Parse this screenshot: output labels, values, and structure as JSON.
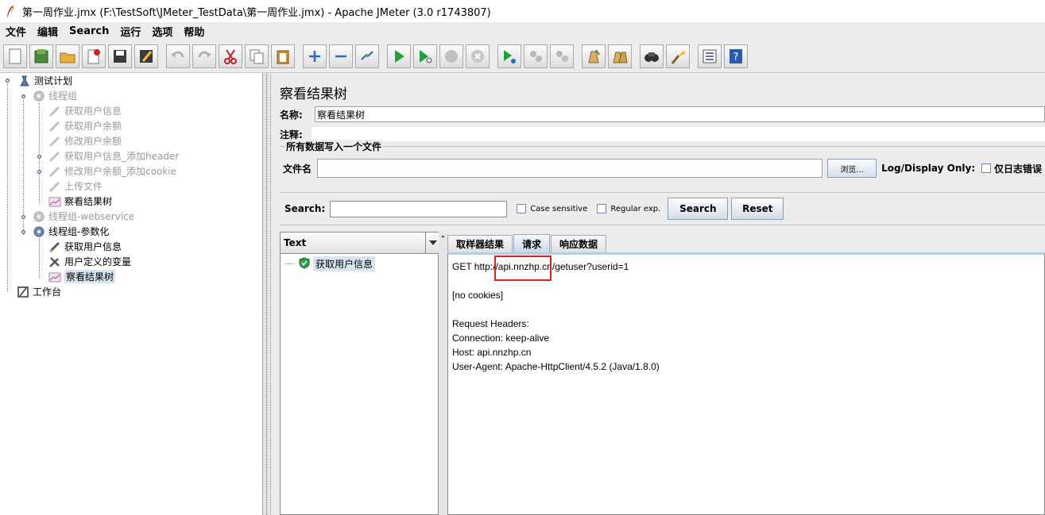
{
  "window": {
    "title": "第一周作业.jmx (F:\\TestSoft\\JMeter_TestData\\第一周作业.jmx) - Apache JMeter (3.0 r1743807)"
  },
  "menu": [
    "文件",
    "编辑",
    "Search",
    "运行",
    "选项",
    "帮助"
  ],
  "toolbar": {
    "icons": [
      "new-icon",
      "templates-icon",
      "open-icon",
      "close-icon",
      "save-icon",
      "save-as-icon",
      "undo-icon",
      "redo-icon",
      "cut-icon",
      "copy-icon",
      "paste-icon",
      "expand-icon",
      "collapse-icon",
      "toggle-icon",
      "start-icon",
      "start-no-pause-icon",
      "stop-icon",
      "shutdown-icon",
      "remote-start-icon",
      "remote-stop-icon",
      "remote-shutdown-icon",
      "clear-icon",
      "clear-all-icon",
      "search-icon",
      "reset-search-icon",
      "function-helper-icon",
      "help-icon"
    ]
  },
  "tree": {
    "items": [
      {
        "label": "测试计划",
        "icon": "test-plan-icon",
        "state": "normal"
      },
      {
        "label": "线程组",
        "icon": "gear-icon",
        "state": "disabled"
      },
      {
        "label": "获取用户信息",
        "icon": "pencil-icon",
        "state": "disabled"
      },
      {
        "label": "获取用户余额",
        "icon": "pencil-icon",
        "state": "disabled"
      },
      {
        "label": "修改用户余额",
        "icon": "pencil-icon",
        "state": "disabled"
      },
      {
        "label": "获取用户信息_添加header",
        "icon": "pencil-icon",
        "state": "disabled"
      },
      {
        "label": "修改用户余额_添加cookie",
        "icon": "pencil-icon",
        "state": "disabled"
      },
      {
        "label": "上传文件",
        "icon": "pencil-icon",
        "state": "disabled"
      },
      {
        "label": "察看结果树",
        "icon": "chart-icon",
        "state": "normal"
      },
      {
        "label": "线程组-webservice",
        "icon": "gear-icon",
        "state": "disabled"
      },
      {
        "label": "线程组-参数化",
        "icon": "gear-icon",
        "state": "normal"
      },
      {
        "label": "获取用户信息",
        "icon": "pencil-icon",
        "state": "normal"
      },
      {
        "label": "用户定义的变量",
        "icon": "wrench-icon",
        "state": "normal"
      },
      {
        "label": "察看结果树",
        "icon": "chart-icon",
        "state": "selected"
      },
      {
        "label": "工作台",
        "icon": "workbench-icon",
        "state": "normal"
      }
    ]
  },
  "panel": {
    "title": "察看结果树",
    "name_label": "名称:",
    "name_value": "察看结果树",
    "comment_label": "注释:",
    "file_group_label": "所有数据写入一个文件",
    "filename_label": "文件名",
    "browse_label": "浏览...",
    "log_display_label": "Log/Display Only:",
    "errors_only_label": "仅日志错误"
  },
  "search": {
    "label": "Search:",
    "case_sensitive_label": "Case sensitive",
    "regex_label": "Regular exp.",
    "search_button": "Search",
    "reset_button": "Reset"
  },
  "results": {
    "renderer": "Text",
    "items": [
      {
        "label": "获取用户信息",
        "status": "success"
      }
    ],
    "tabs": [
      "取样器结果",
      "请求",
      "响应数据"
    ],
    "active_tab": "请求",
    "request_lines": [
      "GET http://api.nnzhp.cn/getuser?userid=1",
      "",
      "[no cookies]",
      "",
      "Request Headers:",
      "Connection: keep-alive",
      "Host: api.nnzhp.cn",
      "User-Agent: Apache-HttpClient/4.5.2 (Java/1.8.0)"
    ]
  },
  "colors": {
    "highlight": "#e02020",
    "disabled_text": "#9a9a9a",
    "selection": "#d8e4f2"
  }
}
